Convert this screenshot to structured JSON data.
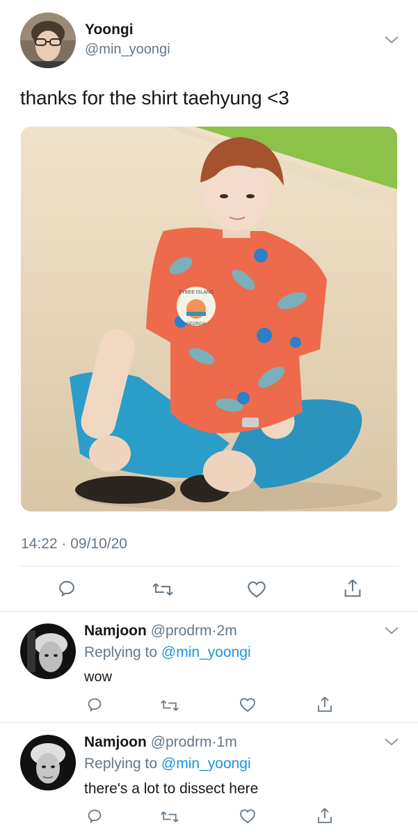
{
  "tweet": {
    "display_name": "Yoongi",
    "handle": "@min_yoongi",
    "text": "thanks for the shirt taehyung <3",
    "timestamp": "14:22 · 09/10/20",
    "photo_badge": {
      "line1": "TYBEE ISLAND",
      "line2": "GEORGIA"
    },
    "actions": [
      "reply-icon",
      "retweet-icon",
      "like-icon",
      "share-icon"
    ]
  },
  "replies": [
    {
      "display_name": "Namjoon",
      "handle": "@prodrm",
      "dot": "·",
      "time": "2m",
      "replying_prefix": "Replying to",
      "replying_handle": "@min_yoongi",
      "text": "wow"
    },
    {
      "display_name": "Namjoon",
      "handle": "@prodrm",
      "dot": "·",
      "time": "1m",
      "replying_prefix": "Replying to",
      "replying_handle": "@min_yoongi",
      "text": "there's a lot to dissect here"
    }
  ],
  "colors": {
    "text": "#14171a",
    "muted": "#657786",
    "link": "#1b95e0",
    "divider": "#e1e8ed",
    "icon": "#657786"
  }
}
